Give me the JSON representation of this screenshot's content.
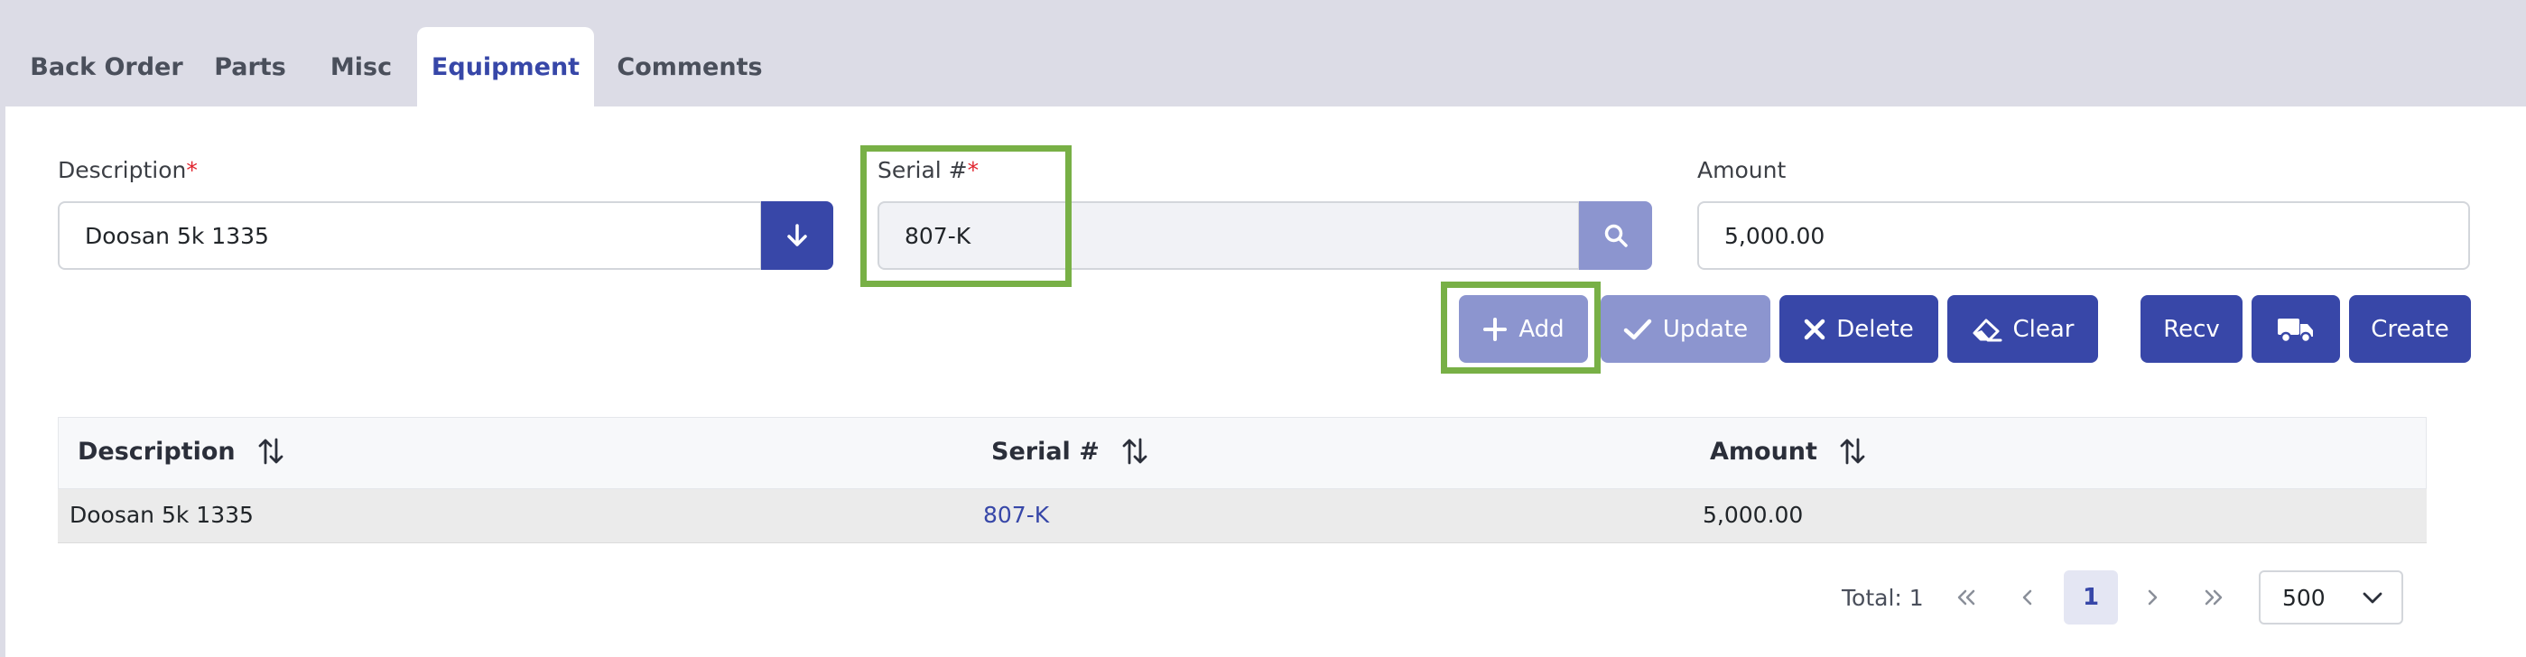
{
  "tabs": [
    {
      "label": "Back Order"
    },
    {
      "label": "Parts"
    },
    {
      "label": "Misc"
    },
    {
      "label": "Equipment",
      "active": true
    },
    {
      "label": "Comments"
    }
  ],
  "form": {
    "description": {
      "label": "Description",
      "required_mark": "*",
      "value": "Doosan 5k 1335"
    },
    "serial": {
      "label": "Serial #",
      "required_mark": "*",
      "value": "807-K"
    },
    "amount": {
      "label": "Amount",
      "value": "5,000.00"
    }
  },
  "actions": {
    "add": "Add",
    "update": "Update",
    "delete": "Delete",
    "clear": "Clear",
    "recv": "Recv",
    "create": "Create"
  },
  "table": {
    "columns": [
      "Description",
      "Serial #",
      "Amount"
    ],
    "rows": [
      {
        "description": "Doosan 5k 1335",
        "serial": "807-K",
        "amount": "5,000.00"
      }
    ]
  },
  "pagination": {
    "total_text": "Total: 1",
    "current_page": "1",
    "page_size": "500"
  },
  "colors": {
    "accent": "#3847a8",
    "highlight": "#78b046",
    "required": "#e0242e"
  }
}
